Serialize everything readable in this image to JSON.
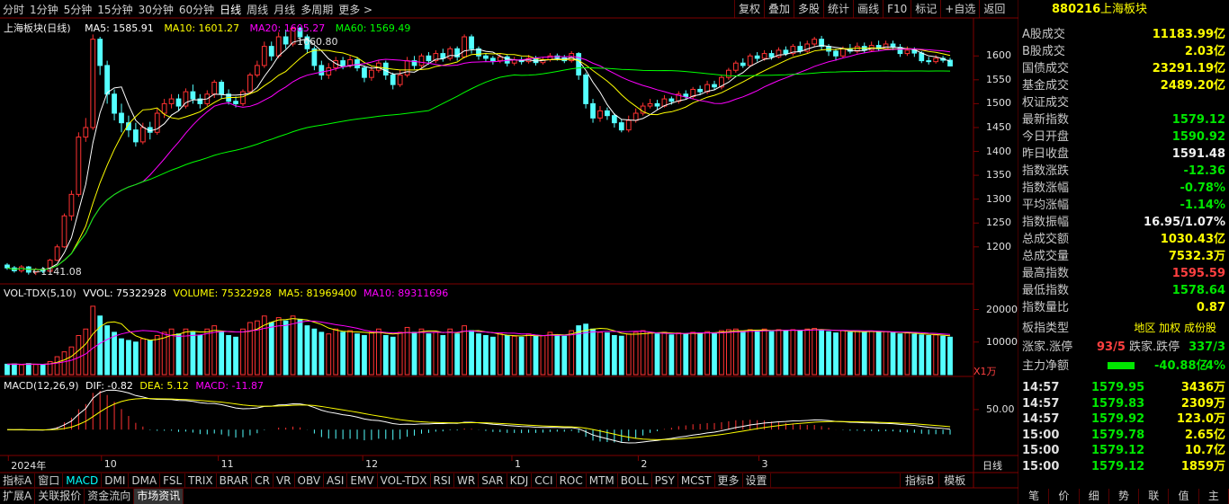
{
  "timeframes": [
    "分时",
    "1分钟",
    "5分钟",
    "15分钟",
    "30分钟",
    "60分钟",
    "日线",
    "周线",
    "月线",
    "多周期",
    "更多 >"
  ],
  "active_timeframe": "日线",
  "tools": [
    "复权",
    "叠加",
    "多股",
    "统计",
    "画线",
    "F10",
    "标记",
    "+自选",
    "返回"
  ],
  "main_legend": {
    "title": "上海板块(日线)",
    "ma5": "MA5: 1585.91",
    "ma10": "MA10: 1601.27",
    "ma20": "MA20: 1605.27",
    "ma60": "MA60: 1569.49"
  },
  "price_annotations": {
    "high": "1660.80",
    "low": "←1141.08"
  },
  "price_axis": [
    "1600",
    "1550",
    "1500",
    "1450",
    "1400",
    "1350",
    "1300",
    "1250",
    "1200"
  ],
  "vol_legend": {
    "name": "VOL-TDX(5,10)",
    "vvol": "VVOL: 75322928",
    "volume": "VOLUME: 75322928",
    "ma5": "MA5: 81969400",
    "ma10": "MA10: 89311696"
  },
  "vol_axis": [
    "20000",
    "10000"
  ],
  "vol_unit": "X1万",
  "macd_legend": {
    "name": "MACD(12,26,9)",
    "dif": "DIF: -0.82",
    "dea": "DEA: 5.12",
    "macd": "MACD: -11.87"
  },
  "macd_axis": [
    "50.00"
  ],
  "date_axis": [
    {
      "label": "2024年",
      "at": 0.005
    },
    {
      "label": "10",
      "at": 0.103
    },
    {
      "label": "11",
      "at": 0.226
    },
    {
      "label": "12",
      "at": 0.378
    },
    {
      "label": "1",
      "at": 0.535
    },
    {
      "label": "2",
      "at": 0.668
    },
    {
      "label": "3",
      "at": 0.795
    }
  ],
  "date_axis_mode": "日线",
  "indicator_tabs": [
    "指标A",
    "窗口",
    "MACD",
    "DMI",
    "DMA",
    "FSL",
    "TRIX",
    "BRAR",
    "CR",
    "VR",
    "OBV",
    "ASI",
    "EMV",
    "VOL-TDX",
    "RSI",
    "WR",
    "SAR",
    "KDJ",
    "CCI",
    "ROC",
    "MTM",
    "BOLL",
    "PSY",
    "MCST",
    "更多",
    "设置"
  ],
  "indicator_right": [
    "指标B",
    "模板"
  ],
  "bottom_tabs": [
    "扩展A",
    "关联报价",
    "资金流向",
    "市场资讯"
  ],
  "active_bottom_tab": "市场资讯",
  "side": {
    "code": "880216",
    "name": "上海板块",
    "rows": [
      {
        "k": "A股成交",
        "v": "11183.99亿",
        "c": "yellow"
      },
      {
        "k": "B股成交",
        "v": "2.03亿",
        "c": "yellow"
      },
      {
        "k": "国债成交",
        "v": "23291.19亿",
        "c": "yellow"
      },
      {
        "k": "基金成交",
        "v": "2489.20亿",
        "c": "yellow"
      },
      {
        "k": "权证成交",
        "v": "",
        "c": "yellow"
      },
      {
        "k": "最新指数",
        "v": "1579.12",
        "c": "green"
      },
      {
        "k": "今日开盘",
        "v": "1590.92",
        "c": "green"
      },
      {
        "k": "昨日收盘",
        "v": "1591.48",
        "c": "white"
      },
      {
        "k": "指数涨跌",
        "v": "-12.36",
        "c": "green"
      },
      {
        "k": "指数涨幅",
        "v": "-0.78%",
        "c": "green"
      },
      {
        "k": "平均涨幅",
        "v": "-1.14%",
        "c": "green"
      },
      {
        "k": "指数振幅",
        "v": "16.95/1.07%",
        "c": "white"
      },
      {
        "k": "总成交额",
        "v": "1030.43亿",
        "c": "yellow"
      },
      {
        "k": "总成交量",
        "v": "7532.3万",
        "c": "yellow"
      },
      {
        "k": "最高指数",
        "v": "1595.59",
        "c": "red"
      },
      {
        "k": "最低指数",
        "v": "1578.64",
        "c": "green"
      },
      {
        "k": "指数量比",
        "v": "0.87",
        "c": "yellow"
      }
    ],
    "type_label": "板指类型",
    "type_value": "地区 加权 成份股",
    "up_label": "涨家.涨停",
    "up_value": "93/5",
    "down_label": "跌家.跌停",
    "down_value": "337/3",
    "flow_label": "主力净额",
    "flow_value": "-40.88亿",
    "flow_pct": "-4%",
    "ticks": [
      {
        "t": "14:57",
        "p": "1579.95",
        "v": "3436万"
      },
      {
        "t": "14:57",
        "p": "1579.83",
        "v": "2309万"
      },
      {
        "t": "14:57",
        "p": "1579.92",
        "v": "123.0万"
      },
      {
        "t": "15:00",
        "p": "1579.78",
        "v": "2.65亿"
      },
      {
        "t": "15:00",
        "p": "1579.12",
        "v": "10.7亿"
      },
      {
        "t": "15:00",
        "p": "1579.12",
        "v": "1859万"
      }
    ],
    "side_tabs": [
      "笔",
      "价",
      "细",
      "势",
      "联",
      "值",
      "主"
    ]
  },
  "colors": {
    "up": "#ff3232",
    "down": "#54ffff",
    "ma5": "#ffffff",
    "ma10": "#ffff00",
    "ma20": "#ff00ff",
    "ma60": "#00ff00",
    "border": "#800000"
  },
  "candles": [
    [
      1162,
      1156,
      1166,
      1152
    ],
    [
      1156,
      1150,
      1160,
      1146
    ],
    [
      1150,
      1158,
      1162,
      1146
    ],
    [
      1158,
      1147,
      1160,
      1142
    ],
    [
      1147,
      1153,
      1156,
      1141
    ],
    [
      1153,
      1149,
      1158,
      1145
    ],
    [
      1149,
      1172,
      1175,
      1147
    ],
    [
      1172,
      1200,
      1205,
      1170
    ],
    [
      1200,
      1265,
      1270,
      1198
    ],
    [
      1265,
      1310,
      1318,
      1255
    ],
    [
      1310,
      1430,
      1440,
      1305
    ],
    [
      1430,
      1450,
      1470,
      1420
    ],
    [
      1450,
      1635,
      1645,
      1445
    ],
    [
      1635,
      1580,
      1640,
      1560
    ],
    [
      1580,
      1520,
      1590,
      1500
    ],
    [
      1520,
      1480,
      1530,
      1465
    ],
    [
      1480,
      1460,
      1500,
      1440
    ],
    [
      1460,
      1445,
      1475,
      1430
    ],
    [
      1445,
      1420,
      1460,
      1410
    ],
    [
      1420,
      1450,
      1460,
      1415
    ],
    [
      1450,
      1440,
      1462,
      1425
    ],
    [
      1440,
      1480,
      1490,
      1435
    ],
    [
      1480,
      1500,
      1510,
      1470
    ],
    [
      1500,
      1510,
      1520,
      1490
    ],
    [
      1510,
      1495,
      1520,
      1485
    ],
    [
      1495,
      1525,
      1532,
      1490
    ],
    [
      1525,
      1510,
      1540,
      1500
    ],
    [
      1510,
      1500,
      1520,
      1490
    ],
    [
      1500,
      1520,
      1528,
      1495
    ],
    [
      1520,
      1545,
      1550,
      1512
    ],
    [
      1545,
      1520,
      1550,
      1510
    ],
    [
      1520,
      1505,
      1530,
      1498
    ],
    [
      1505,
      1500,
      1515,
      1492
    ],
    [
      1500,
      1525,
      1530,
      1495
    ],
    [
      1525,
      1560,
      1565,
      1520
    ],
    [
      1560,
      1580,
      1590,
      1555
    ],
    [
      1580,
      1620,
      1630,
      1575
    ],
    [
      1620,
      1600,
      1630,
      1590
    ],
    [
      1600,
      1640,
      1650,
      1595
    ],
    [
      1640,
      1625,
      1655,
      1615
    ],
    [
      1625,
      1658,
      1661,
      1620
    ],
    [
      1658,
      1640,
      1661,
      1625
    ],
    [
      1640,
      1615,
      1645,
      1605
    ],
    [
      1615,
      1580,
      1620,
      1570
    ],
    [
      1580,
      1560,
      1590,
      1550
    ],
    [
      1560,
      1575,
      1585,
      1552
    ],
    [
      1575,
      1590,
      1598,
      1568
    ],
    [
      1590,
      1580,
      1598,
      1572
    ],
    [
      1580,
      1592,
      1600,
      1575
    ],
    [
      1592,
      1575,
      1598,
      1568
    ],
    [
      1575,
      1555,
      1580,
      1545
    ],
    [
      1555,
      1570,
      1578,
      1548
    ],
    [
      1570,
      1585,
      1592,
      1565
    ],
    [
      1585,
      1560,
      1590,
      1550
    ],
    [
      1560,
      1540,
      1565,
      1530
    ],
    [
      1540,
      1560,
      1570,
      1535
    ],
    [
      1560,
      1590,
      1598,
      1555
    ],
    [
      1590,
      1580,
      1600,
      1572
    ],
    [
      1580,
      1600,
      1605,
      1575
    ],
    [
      1600,
      1590,
      1608,
      1582
    ],
    [
      1590,
      1605,
      1612,
      1585
    ],
    [
      1605,
      1595,
      1615,
      1588
    ],
    [
      1595,
      1615,
      1620,
      1590
    ],
    [
      1615,
      1598,
      1620,
      1590
    ],
    [
      1598,
      1640,
      1645,
      1595
    ],
    [
      1640,
      1615,
      1645,
      1605
    ],
    [
      1615,
      1600,
      1620,
      1592
    ],
    [
      1600,
      1595,
      1605,
      1588
    ],
    [
      1595,
      1590,
      1600,
      1582
    ],
    [
      1590,
      1598,
      1605,
      1585
    ],
    [
      1598,
      1585,
      1602,
      1578
    ],
    [
      1585,
      1592,
      1598,
      1580
    ],
    [
      1592,
      1588,
      1598,
      1582
    ],
    [
      1588,
      1595,
      1602,
      1584
    ],
    [
      1595,
      1586,
      1600,
      1580
    ],
    [
      1586,
      1592,
      1598,
      1582
    ],
    [
      1592,
      1600,
      1606,
      1588
    ],
    [
      1600,
      1596,
      1605,
      1590
    ],
    [
      1596,
      1590,
      1602,
      1585
    ],
    [
      1590,
      1605,
      1610,
      1586
    ],
    [
      1605,
      1560,
      1608,
      1550
    ],
    [
      1560,
      1500,
      1565,
      1490
    ],
    [
      1500,
      1470,
      1510,
      1460
    ],
    [
      1470,
      1485,
      1495,
      1462
    ],
    [
      1485,
      1475,
      1492,
      1466
    ],
    [
      1475,
      1460,
      1480,
      1450
    ],
    [
      1460,
      1445,
      1468,
      1440
    ],
    [
      1445,
      1465,
      1475,
      1440
    ],
    [
      1465,
      1480,
      1490,
      1460
    ],
    [
      1480,
      1495,
      1502,
      1475
    ],
    [
      1495,
      1500,
      1510,
      1490
    ],
    [
      1500,
      1495,
      1508,
      1488
    ],
    [
      1495,
      1510,
      1518,
      1492
    ],
    [
      1510,
      1505,
      1515,
      1498
    ],
    [
      1505,
      1520,
      1526,
      1500
    ],
    [
      1520,
      1515,
      1528,
      1510
    ],
    [
      1515,
      1530,
      1535,
      1510
    ],
    [
      1530,
      1525,
      1538,
      1518
    ],
    [
      1525,
      1540,
      1548,
      1520
    ],
    [
      1540,
      1535,
      1548,
      1528
    ],
    [
      1535,
      1555,
      1560,
      1530
    ],
    [
      1555,
      1570,
      1575,
      1550
    ],
    [
      1570,
      1585,
      1590,
      1565
    ],
    [
      1585,
      1580,
      1595,
      1575
    ],
    [
      1580,
      1600,
      1605,
      1578
    ],
    [
      1600,
      1595,
      1608,
      1588
    ],
    [
      1595,
      1605,
      1612,
      1590
    ],
    [
      1605,
      1598,
      1612,
      1592
    ],
    [
      1598,
      1612,
      1618,
      1595
    ],
    [
      1612,
      1605,
      1620,
      1600
    ],
    [
      1605,
      1620,
      1625,
      1600
    ],
    [
      1620,
      1610,
      1630,
      1605
    ],
    [
      1610,
      1625,
      1632,
      1606
    ],
    [
      1625,
      1635,
      1640,
      1620
    ],
    [
      1635,
      1620,
      1642,
      1612
    ],
    [
      1620,
      1610,
      1625,
      1600
    ],
    [
      1610,
      1600,
      1615,
      1590
    ],
    [
      1600,
      1615,
      1620,
      1595
    ],
    [
      1615,
      1610,
      1625,
      1605
    ],
    [
      1610,
      1620,
      1628,
      1605
    ],
    [
      1620,
      1612,
      1628,
      1606
    ],
    [
      1612,
      1622,
      1630,
      1608
    ],
    [
      1622,
      1615,
      1632,
      1610
    ],
    [
      1615,
      1625,
      1632,
      1612
    ],
    [
      1625,
      1618,
      1632,
      1612
    ],
    [
      1618,
      1605,
      1625,
      1598
    ],
    [
      1605,
      1612,
      1620,
      1600
    ],
    [
      1612,
      1606,
      1618,
      1598
    ],
    [
      1606,
      1590,
      1610,
      1585
    ],
    [
      1590,
      1588,
      1598,
      1582
    ],
    [
      1588,
      1595,
      1602,
      1584
    ],
    [
      1595,
      1591,
      1600,
      1586
    ],
    [
      1591,
      1579,
      1596,
      1578
    ]
  ],
  "volumes": [
    32,
    33,
    30,
    34,
    31,
    30,
    40,
    55,
    70,
    85,
    120,
    140,
    210,
    180,
    150,
    130,
    110,
    105,
    100,
    110,
    105,
    120,
    130,
    140,
    125,
    140,
    130,
    120,
    140,
    150,
    130,
    120,
    115,
    140,
    160,
    165,
    180,
    160,
    175,
    165,
    180,
    170,
    150,
    140,
    130,
    125,
    140,
    130,
    135,
    125,
    120,
    130,
    140,
    120,
    115,
    130,
    145,
    130,
    140,
    125,
    130,
    120,
    140,
    125,
    150,
    135,
    125,
    120,
    115,
    125,
    120,
    118,
    115,
    125,
    118,
    120,
    130,
    122,
    118,
    135,
    150,
    155,
    140,
    130,
    128,
    120,
    118,
    125,
    130,
    135,
    128,
    125,
    130,
    122,
    128,
    125,
    130,
    128,
    132,
    128,
    135,
    138,
    140,
    132,
    138,
    135,
    140,
    132,
    138,
    135,
    138,
    135,
    140,
    142,
    138,
    132,
    128,
    135,
    130,
    135,
    130,
    134,
    130,
    132,
    128,
    125,
    128,
    124,
    122,
    120,
    122,
    118,
    115
  ]
}
